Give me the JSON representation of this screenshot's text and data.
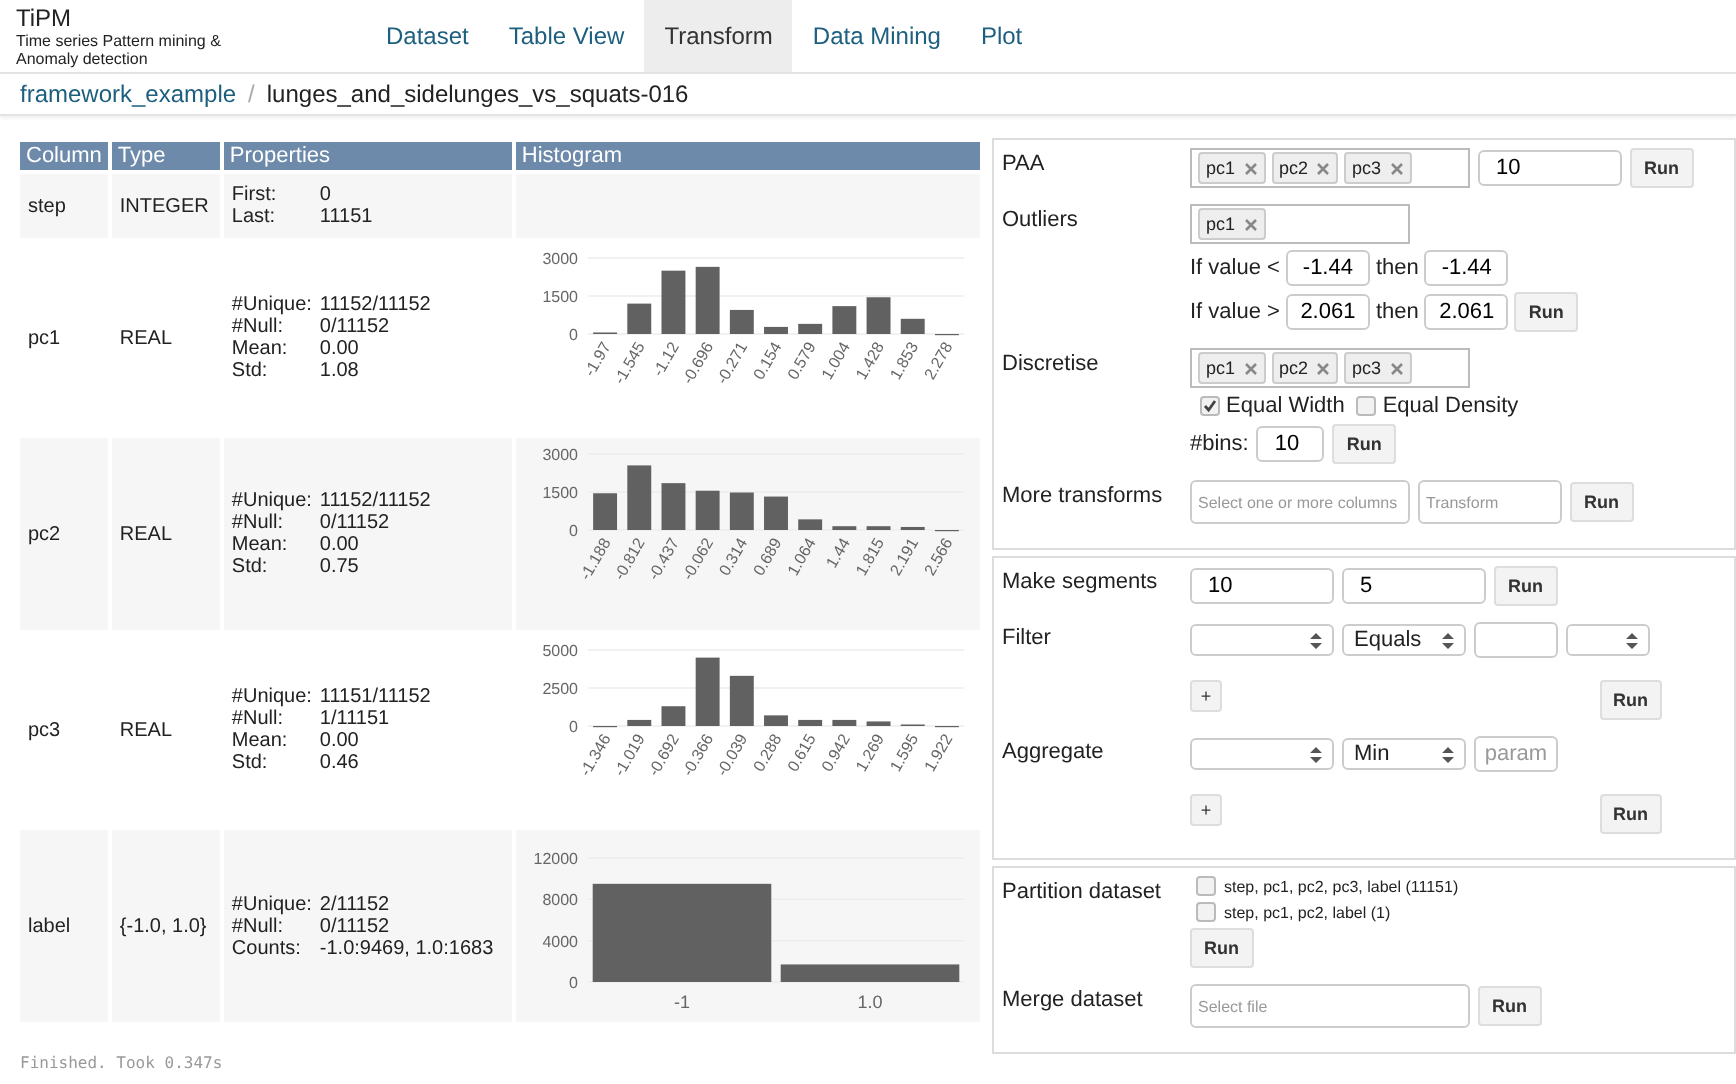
{
  "app": {
    "title": "TiPM",
    "subtitle": "Time series Pattern mining & Anomaly detection"
  },
  "nav": {
    "tabs": [
      {
        "label": "Dataset",
        "selected": false
      },
      {
        "label": "Table View",
        "selected": false
      },
      {
        "label": "Transform",
        "selected": true
      },
      {
        "label": "Data Mining",
        "selected": false
      },
      {
        "label": "Plot",
        "selected": false
      }
    ]
  },
  "breadcrumb": {
    "parent": "framework_example",
    "separator": "/",
    "current": "lunges_and_sidelunges_vs_squats-016"
  },
  "table": {
    "columns": [
      "Column",
      "Type",
      "Properties",
      "Histogram"
    ],
    "rows": [
      {
        "column": "step",
        "type": "INTEGER",
        "properties": [
          {
            "key": "First:",
            "value": "0"
          },
          {
            "key": "Last:",
            "value": "11151"
          }
        ]
      },
      {
        "column": "pc1",
        "type": "REAL",
        "properties": [
          {
            "key": "#Unique:",
            "value": "11152/11152"
          },
          {
            "key": "#Null:",
            "value": "0/11152"
          },
          {
            "key": "Mean:",
            "value": "0.00"
          },
          {
            "key": "Std:",
            "value": "1.08"
          }
        ],
        "chart_data": {
          "type": "bar",
          "categories": [
            "-1.97",
            "-1.545",
            "-1.12",
            "-0.696",
            "-0.271",
            "0.154",
            "0.579",
            "1.004",
            "1.428",
            "1.853",
            "2.278"
          ],
          "values": [
            60,
            1200,
            2500,
            2650,
            950,
            280,
            400,
            1100,
            1450,
            600,
            0
          ],
          "ylim": [
            0,
            3000
          ],
          "yticks": [
            0,
            1500,
            3000
          ]
        }
      },
      {
        "column": "pc2",
        "type": "REAL",
        "properties": [
          {
            "key": "#Unique:",
            "value": "11152/11152"
          },
          {
            "key": "#Null:",
            "value": "0/11152"
          },
          {
            "key": "Mean:",
            "value": "0.00"
          },
          {
            "key": "Std:",
            "value": "0.75"
          }
        ],
        "chart_data": {
          "type": "bar",
          "categories": [
            "-1.188",
            "-0.812",
            "-0.437",
            "-0.062",
            "0.314",
            "0.689",
            "1.064",
            "1.44",
            "1.815",
            "2.191",
            "2.566"
          ],
          "values": [
            1450,
            2550,
            1850,
            1550,
            1480,
            1320,
            420,
            150,
            150,
            120,
            0
          ],
          "ylim": [
            0,
            3000
          ],
          "yticks": [
            0,
            1500,
            3000
          ]
        }
      },
      {
        "column": "pc3",
        "type": "REAL",
        "properties": [
          {
            "key": "#Unique:",
            "value": "11151/11152"
          },
          {
            "key": "#Null:",
            "value": "1/11151"
          },
          {
            "key": "Mean:",
            "value": "0.00"
          },
          {
            "key": "Std:",
            "value": "0.46"
          }
        ],
        "chart_data": {
          "type": "bar",
          "categories": [
            "-1.346",
            "-1.019",
            "-0.692",
            "-0.366",
            "-0.039",
            "0.288",
            "0.615",
            "0.942",
            "1.269",
            "1.595",
            "1.922"
          ],
          "values": [
            0,
            400,
            1300,
            4500,
            3300,
            700,
            400,
            400,
            300,
            100,
            0
          ],
          "ylim": [
            0,
            5000
          ],
          "yticks": [
            0,
            2500,
            5000
          ]
        }
      },
      {
        "column": "label",
        "type": "{-1.0, 1.0}",
        "properties": [
          {
            "key": "#Unique:",
            "value": "2/11152"
          },
          {
            "key": "#Null:",
            "value": "0/11152"
          },
          {
            "key": "Counts:",
            "value": "-1.0:9469, 1.0:1683"
          }
        ],
        "chart_data": {
          "type": "bar",
          "categories": [
            "-1",
            "1.0"
          ],
          "values": [
            9500,
            1700
          ],
          "ylim": [
            0,
            12000
          ],
          "yticks": [
            0,
            4000,
            8000,
            12000
          ]
        }
      }
    ]
  },
  "status": "Finished. Took 0.347s",
  "transform_panel": {
    "paa": {
      "label": "PAA",
      "columns": [
        "pc1",
        "pc2",
        "pc3"
      ],
      "value": "10",
      "button": "Run"
    },
    "outliers": {
      "label": "Outliers",
      "columns": [
        "pc1"
      ],
      "rules": [
        {
          "condition": "If value <",
          "value": "-1.44",
          "then": "then",
          "replacement": "-1.44"
        },
        {
          "condition": "If value >",
          "value": "2.061",
          "then": "then",
          "replacement": "2.061"
        }
      ],
      "button": "Run"
    },
    "discretise": {
      "label": "Discretise",
      "columns": [
        "pc1",
        "pc2",
        "pc3"
      ],
      "options": [
        {
          "label": "Equal Width",
          "checked": true
        },
        {
          "label": "Equal Density",
          "checked": false
        }
      ],
      "bins_label": "#bins:",
      "bins": "10",
      "button": "Run"
    },
    "more": {
      "label": "More transforms",
      "columns_placeholder": "Select one or more columns",
      "transform_placeholder": "Transform",
      "button": "Run"
    }
  },
  "segment_panel": {
    "make_segments": {
      "label": "Make segments",
      "values": [
        "10",
        "5"
      ],
      "button": "Run"
    },
    "filter": {
      "label": "Filter",
      "fields": [
        {
          "kind": "select"
        },
        {
          "kind": "select",
          "value": "Equals"
        },
        {
          "kind": "input"
        },
        {
          "kind": "select"
        }
      ],
      "add": "+",
      "button": "Run"
    },
    "aggregate": {
      "label": "Aggregate",
      "fields": [
        {
          "kind": "select"
        },
        {
          "kind": "select",
          "value": "Min"
        },
        {
          "kind": "input",
          "placeholder": "param"
        }
      ],
      "add": "+",
      "button": "Run"
    }
  },
  "dataset_panel": {
    "partition": {
      "label": "Partition dataset",
      "options": [
        {
          "label": "step, pc1, pc2, pc3, label (11151)",
          "checked": false
        },
        {
          "label": "step, pc1, pc2, label (1)",
          "checked": false
        }
      ],
      "button": "Run"
    },
    "merge": {
      "label": "Merge dataset",
      "placeholder": "Select file",
      "button": "Run"
    }
  }
}
